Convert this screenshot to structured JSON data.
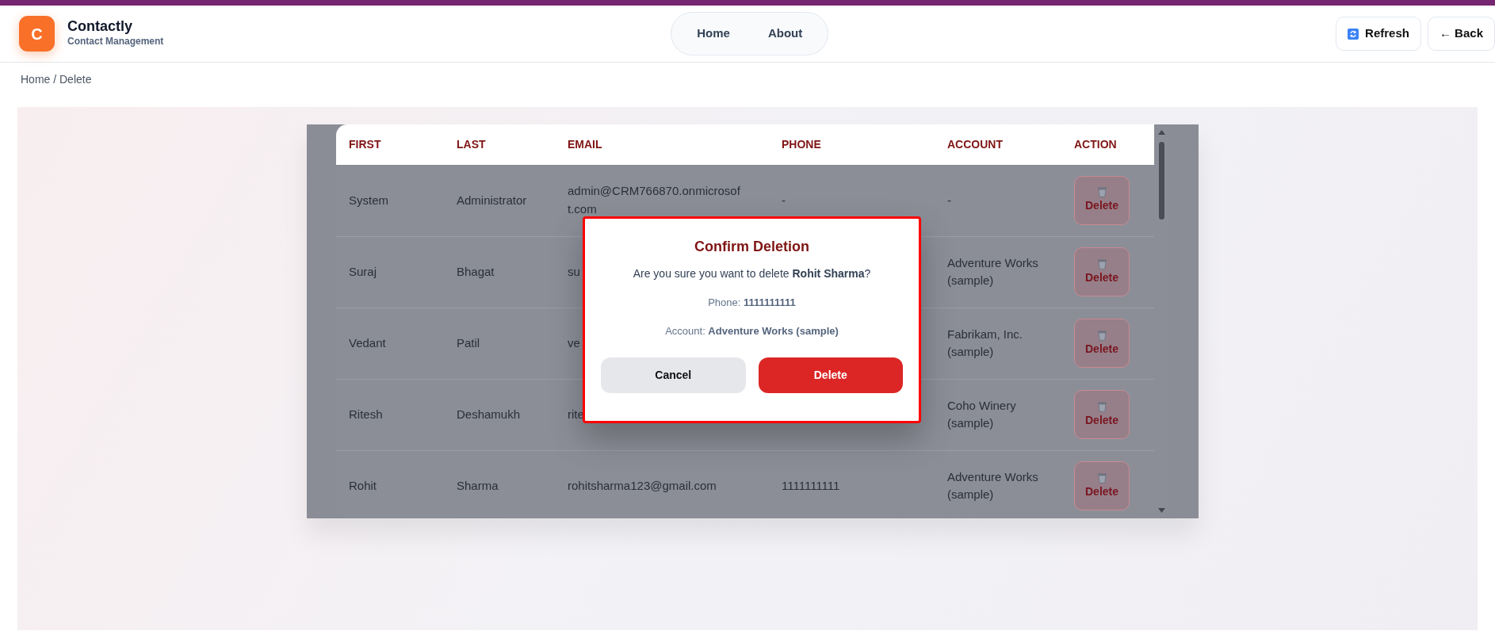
{
  "header": {
    "logo": {
      "letter": "C"
    },
    "title": "Contactly",
    "subtitle": "Contact Management",
    "nav": [
      {
        "label": "Home"
      },
      {
        "label": "About"
      }
    ],
    "actions": [
      {
        "label": "Refresh",
        "kind": "refresh"
      },
      {
        "label": "← Back",
        "kind": "back"
      }
    ]
  },
  "breadcrumb": "Home / Delete",
  "table": {
    "columns": [
      "FIRST",
      "LAST",
      "EMAIL",
      "PHONE",
      "ACCOUNT",
      "ACTION"
    ],
    "rows": [
      {
        "first": "System",
        "last": "Administrator",
        "email": "admin@CRM766870.onmicrosoft.com",
        "phone": "-",
        "account": "-",
        "action": "Delete"
      },
      {
        "first": "Suraj",
        "last": "Bhagat",
        "email": "su",
        "account": "Adventure Works (sample)",
        "action": "Delete"
      },
      {
        "first": "Vedant",
        "last": "Patil",
        "email": "ve",
        "account": "Fabrikam, Inc. (sample)",
        "action": "Delete"
      },
      {
        "first": "Ritesh",
        "last": "Deshamukh",
        "email": "rite",
        "account": "Coho Winery (sample)",
        "action": "Delete"
      },
      {
        "first": "Rohit",
        "last": "Sharma",
        "email": "rohitsharma123@gmail.com",
        "phone": "1111111111",
        "account": "Adventure Works (sample)",
        "action": "Delete"
      }
    ]
  },
  "modal": {
    "title": "Confirm Deletion",
    "message": "Are you sure you want to delete **Rohit Sharma**?",
    "phone": "Phone: **1111111111**",
    "account": "Account: **Adventure Works (sample)**",
    "buttons": [
      {
        "label": "Cancel",
        "kind": "secondary"
      },
      {
        "label": "Delete",
        "kind": "danger"
      }
    ]
  }
}
